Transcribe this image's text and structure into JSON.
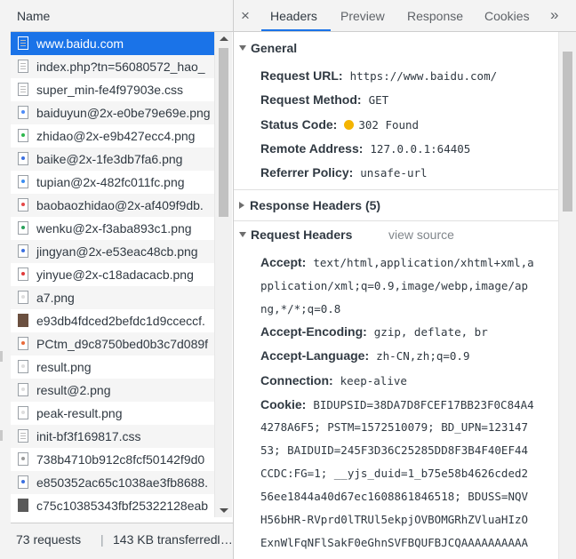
{
  "left": {
    "header": "Name",
    "requests": [
      {
        "name": "www.baidu.com",
        "icon": "document-icon",
        "color": ""
      },
      {
        "name": "index.php?tn=56080572_hao_",
        "icon": "document-icon",
        "color": ""
      },
      {
        "name": "super_min-fe4f97903e.css",
        "icon": "document-icon",
        "color": ""
      },
      {
        "name": "baiduyun@2x-e0be79e69e.png",
        "icon": "image-icon",
        "color": "#4e8cf7"
      },
      {
        "name": "zhidao@2x-e9b427ecc4.png",
        "icon": "image-icon",
        "color": "#2db84d"
      },
      {
        "name": "baike@2x-1fe3db7fa6.png",
        "icon": "image-icon",
        "color": "#3b6fe0"
      },
      {
        "name": "tupian@2x-482fc011fc.png",
        "icon": "image-icon",
        "color": "#3b8df0"
      },
      {
        "name": "baobaozhidao@2x-af409f9db.",
        "icon": "image-icon",
        "color": "#e54848"
      },
      {
        "name": "wenku@2x-f3aba893c1.png",
        "icon": "image-icon",
        "color": "#27a05a"
      },
      {
        "name": "jingyan@2x-e53eac48cb.png",
        "icon": "image-icon",
        "color": "#3b6fe0"
      },
      {
        "name": "yinyue@2x-c18adacacb.png",
        "icon": "image-icon",
        "color": "#e03a3a"
      },
      {
        "name": "a7.png",
        "icon": "image-icon",
        "color": "#dddddd"
      },
      {
        "name": "e93db4fdced2befdc1d9cceccf.",
        "icon": "photo-icon",
        "color": "#6b5040"
      },
      {
        "name": "PCtm_d9c8750bed0b3c7d089f",
        "icon": "image-icon",
        "color": "#e86a3a"
      },
      {
        "name": "result.png",
        "icon": "image-icon",
        "color": "#dddddd"
      },
      {
        "name": "result@2.png",
        "icon": "image-icon",
        "color": "#dddddd"
      },
      {
        "name": "peak-result.png",
        "icon": "image-icon",
        "color": "#dddddd"
      },
      {
        "name": "init-bf3f169817.css",
        "icon": "document-icon",
        "color": ""
      },
      {
        "name": "738b4710b912c8fcf50142f9d0",
        "icon": "image-icon",
        "color": "#9a9a9a"
      },
      {
        "name": "e850352ac65c1038ae3fb8688.",
        "icon": "image-icon",
        "color": "#3b6fe0"
      },
      {
        "name": "c75c10385343fbf25322128eab",
        "icon": "photo-icon",
        "color": "#5a5a5a"
      }
    ],
    "status_requests": "73 requests",
    "status_sep": "|",
    "status_transferred": "143 KB transferred",
    "status_more": "I…"
  },
  "tabs": {
    "close": "×",
    "items": [
      "Headers",
      "Preview",
      "Response",
      "Cookies"
    ],
    "more": "»"
  },
  "general": {
    "title": "General",
    "request_url_label": "Request URL:",
    "request_url": "https://www.baidu.com/",
    "request_method_label": "Request Method:",
    "request_method": "GET",
    "status_code_label": "Status Code:",
    "status_code": "302 Found",
    "status_color": "#f4b400",
    "remote_address_label": "Remote Address:",
    "remote_address": "127.0.0.1:64405",
    "referrer_policy_label": "Referrer Policy:",
    "referrer_policy": "unsafe-url"
  },
  "response_headers": {
    "title": "Response Headers (5)"
  },
  "request_headers": {
    "title": "Request Headers",
    "view_source": "view source",
    "accept_label": "Accept:",
    "accept_lines": [
      "text/html,application/xhtml+xml,a",
      "pplication/xml;q=0.9,image/webp,image/ap",
      "ng,*/*;q=0.8"
    ],
    "accept_encoding_label": "Accept-Encoding:",
    "accept_encoding": "gzip, deflate, br",
    "accept_language_label": "Accept-Language:",
    "accept_language": "zh-CN,zh;q=0.9",
    "connection_label": "Connection:",
    "connection": "keep-alive",
    "cookie_label": "Cookie:",
    "cookie_lines": [
      "BIDUPSID=38DA7D8FCEF17BB23F0C84A4",
      "4278A6F5; PSTM=1572510079; BD_UPN=123147",
      "53; BAIDUID=245F3D36C25285DD8F3B4F40EF44",
      "CCDC:FG=1; __yjs_duid=1_b75e58b4626cded2",
      "56ee1844a40d67ec1608861846518; BDUSS=NQV",
      "H56bHR-RVprd0lTRUl5ekpjOVBOMGRhZVluaHIzO",
      "ExnWlFqNFlSakF0eGhnSVFBQUFBJCQAAAAAAAAAA"
    ]
  }
}
